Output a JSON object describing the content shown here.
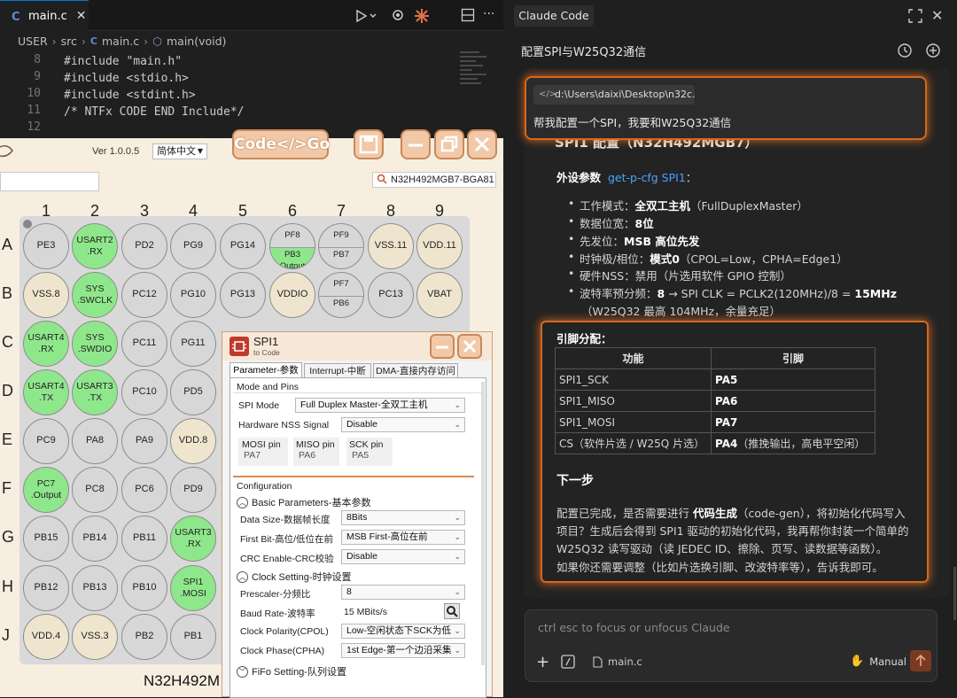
{
  "editor": {
    "tab_label": "main.c",
    "tab_icon": "c-file-icon",
    "breadcrumb": [
      "USER",
      "src",
      "main.c",
      "main(void)"
    ],
    "lines": [
      {
        "num": "8",
        "text": "#include \"main.h\""
      },
      {
        "num": "9",
        "text": "#include <stdio.h>"
      },
      {
        "num": "10",
        "text": "#include <stdint.h>"
      },
      {
        "num": "11",
        "text": "/* NTFx CODE END Include*/"
      },
      {
        "num": "12",
        "text": ""
      }
    ]
  },
  "pintool": {
    "version": "Ver 1.0.0.5",
    "language": "简体中文",
    "codego_label": "Code</>Go",
    "chip_name": "N32H492MGB7-BGA81",
    "bottom_label": "N32H492M",
    "columns": [
      "1",
      "2",
      "3",
      "4",
      "5",
      "6",
      "7",
      "8",
      "9"
    ],
    "rows": [
      "A",
      "B",
      "C",
      "D",
      "E",
      "F",
      "G",
      "H",
      "J"
    ],
    "pins": {
      "A": [
        {
          "t": "PE3"
        },
        {
          "t": "USART2\n.RX",
          "c": "g"
        },
        {
          "t": "PD2"
        },
        {
          "t": "PG9"
        },
        {
          "t": "PG14"
        },
        {
          "top": "PF8",
          "bot": "PB3\nOutput",
          "botc": "g"
        },
        {
          "top": "PF9",
          "bot": "PB7"
        },
        {
          "t": "VSS.11",
          "c": "y"
        },
        {
          "t": "VDD.11",
          "c": "y"
        }
      ],
      "B": [
        {
          "t": "VSS.8",
          "c": "y"
        },
        {
          "t": "SYS\n.SWCLK",
          "c": "g"
        },
        {
          "t": "PC12"
        },
        {
          "t": "PG10"
        },
        {
          "t": "PG13"
        },
        {
          "t": "VDDIO",
          "c": "y"
        },
        {
          "top": "PF7",
          "bot": "PB6"
        },
        {
          "t": "PC13"
        },
        {
          "t": "VBAT",
          "c": "y"
        }
      ],
      "C": [
        {
          "t": "USART4\n.RX",
          "c": "g"
        },
        {
          "t": "SYS\n.SWDIO",
          "c": "g"
        },
        {
          "t": "PC11"
        },
        {
          "t": "PG11"
        }
      ],
      "D": [
        {
          "t": "USART4\n.TX",
          "c": "g"
        },
        {
          "t": "USART3\n.TX",
          "c": "g"
        },
        {
          "t": "PC10"
        },
        {
          "t": "PD5"
        }
      ],
      "E": [
        {
          "t": "PC9"
        },
        {
          "t": "PA8"
        },
        {
          "t": "PA9"
        },
        {
          "t": "VDD.8",
          "c": "y"
        }
      ],
      "F": [
        {
          "t": "PC7\n.Output",
          "c": "g"
        },
        {
          "t": "PC8"
        },
        {
          "t": "PC6"
        },
        {
          "t": "PD9"
        }
      ],
      "G": [
        {
          "t": "PB15"
        },
        {
          "t": "PB14"
        },
        {
          "t": "PB11"
        },
        {
          "t": "USART3\n.RX",
          "c": "g"
        }
      ],
      "H": [
        {
          "t": "PB12"
        },
        {
          "t": "PB13"
        },
        {
          "t": "PB10"
        },
        {
          "t": "SPI1\n.MOSI",
          "c": "g"
        }
      ],
      "J": [
        {
          "t": "VDD.4",
          "c": "y"
        },
        {
          "t": "VSS.3",
          "c": "y"
        },
        {
          "t": "PB2"
        },
        {
          "t": "PB1"
        }
      ]
    }
  },
  "spi": {
    "title": "SPI1",
    "subtitle": "to Code",
    "tabs": [
      "Parameter-参数",
      "Interrupt-中断",
      "DMA-直接内存访问"
    ],
    "mode_group": "Mode and Pins",
    "spi_mode_label": "SPI Mode",
    "spi_mode_value": "Full Duplex Master-全双工主机",
    "nss_label": "Hardware NSS Signal",
    "nss_value": "Disable",
    "mosi_label": "MOSI pin",
    "mosi_value": "PA7",
    "miso_label": "MISO pin",
    "miso_value": "PA6",
    "sck_label": "SCK pin",
    "sck_value": "PA5",
    "config_group": "Configuration",
    "basic_header": "Basic Parameters-基本参数",
    "data_size_label": "Data Size-数据帧长度",
    "data_size_value": "8Bits",
    "first_bit_label": "First Bit-高位/低位在前",
    "first_bit_value": "MSB First-高位在前",
    "crc_label": "CRC Enable-CRC校验",
    "crc_value": "Disable",
    "clock_header": "Clock Setting-时钟设置",
    "prescaler_label": "Prescaler-分频比",
    "prescaler_value": "8",
    "baud_label": "Baud Rate-波特率",
    "baud_value": "15 MBits/s",
    "cpol_label": "Clock Polarity(CPOL)",
    "cpol_value": "Low-空闲状态下SCK为低",
    "cpha_label": "Clock Phase(CPHA)",
    "cpha_value": "1st Edge-第一个边沿采集",
    "fifo_header": "FiFo Setting-队列设置"
  },
  "claude": {
    "panel_title": "Claude Code",
    "conversation_title": "配置SPI与W25Q32通信",
    "user_path": "d:\\Users\\daixi\\Desktop\\n32c...",
    "user_message": "帮我配置一个SPI，我要和W25Q32通信",
    "partial_heading": "SPI1 配置（N32H492MGB7）",
    "params_label": "外设参数",
    "params_link": "get-p-cfg SPI1",
    "params_colon": "：",
    "bullets": [
      {
        "pre": "工作模式：",
        "bold": "全双工主机",
        "post": "（FullDuplexMaster）"
      },
      {
        "pre": "数据位宽：",
        "bold": "8位",
        "post": ""
      },
      {
        "pre": "先发位：",
        "bold": "MSB 高位先发",
        "post": ""
      },
      {
        "pre": "时钟极/相位：",
        "bold": "模式0",
        "post": "（CPOL=Low，CPHA=Edge1）"
      },
      {
        "pre": "硬件NSS：禁用（片选用软件 GPIO 控制）",
        "bold": "",
        "post": ""
      },
      {
        "pre": "波特率预分频：",
        "bold": "8",
        "post": " → SPI CLK = PCLK2(120MHz)/8 = ",
        "bold2": "15MHz"
      }
    ],
    "bullet_cont": "（W25Q32 最高 104MHz，余量充足）",
    "pin_heading": "引脚分配：",
    "table_headers": [
      "功能",
      "引脚"
    ],
    "table_rows": [
      {
        "func": "SPI1_SCK",
        "pin": "PA5",
        "note": ""
      },
      {
        "func": "SPI1_MISO",
        "pin": "PA6",
        "note": ""
      },
      {
        "func": "SPI1_MOSI",
        "pin": "PA7",
        "note": ""
      },
      {
        "func": "CS（软件片选 / W25Q 片选）",
        "pin": "PA4",
        "note": "（推挽输出，高电平空闲）"
      }
    ],
    "next_heading": "下一步",
    "next_p1_pre": "配置已完成，是否需要进行 ",
    "next_p1_bold": "代码生成",
    "next_p1_line1_post": "（code-gen），将初始化代码写入",
    "next_p1_line2": "项目？生成后会得到 SPI1 驱动的初始化代码，我再帮你封装一个简单的",
    "next_p1_line3": "W25Q32 读写驱动（读 JEDEC ID、擦除、页写、读数据等函数）。",
    "next_p2": "如果你还需要调整（比如片选换引脚、改波特率等），告诉我即可。",
    "input_placeholder": "ctrl esc to focus or unfocus Claude",
    "file_chip": "main.c",
    "mode_label": "Manual",
    "accent": "#d2691e"
  }
}
